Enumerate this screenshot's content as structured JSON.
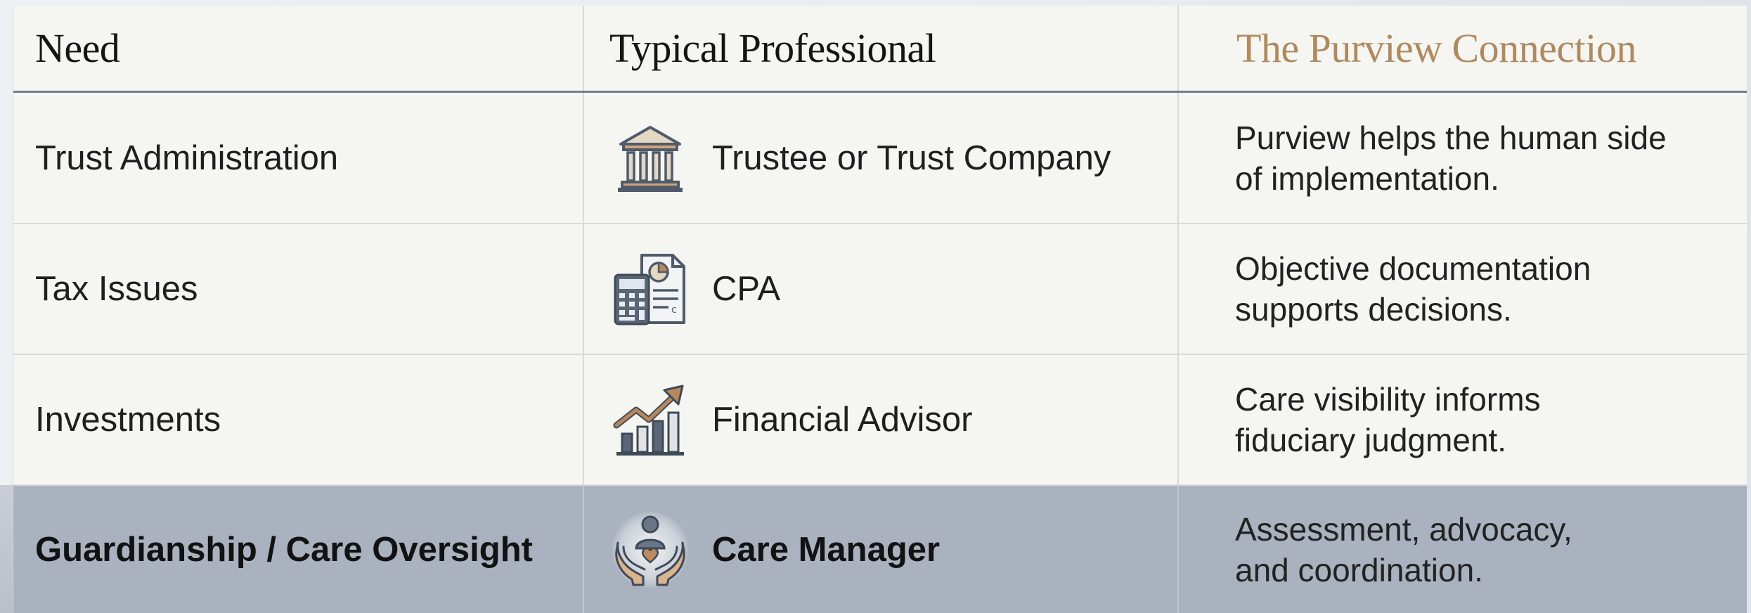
{
  "header": {
    "need": "Need",
    "professional": "Typical Professional",
    "connection": "The Purview Connection"
  },
  "rows": [
    {
      "need": "Trust Administration",
      "professional": "Trustee or Trust Company",
      "icon": "bank-building-icon",
      "connection_line1": "Purview helps the human side",
      "connection_line2": "of implementation."
    },
    {
      "need": "Tax Issues",
      "professional": "CPA",
      "icon": "calculator-document-icon",
      "connection_line1": "Objective documentation",
      "connection_line2": "supports decisions."
    },
    {
      "need": "Investments",
      "professional": "Financial Advisor",
      "icon": "growth-chart-icon",
      "connection_line1": "Care visibility informs",
      "connection_line2": "fiduciary judgment."
    },
    {
      "need": "Guardianship / Care Oversight",
      "professional": "Care Manager",
      "icon": "caring-hands-person-icon",
      "connection_line1": "Assessment, advocacy,",
      "connection_line2": "and coordination.",
      "highlighted": true
    }
  ],
  "colors": {
    "accent": "#b08a5e",
    "highlight_row": "#a9b2be",
    "header_rule": "#6f7d8f",
    "icon_slate": "#4f5b6b"
  }
}
